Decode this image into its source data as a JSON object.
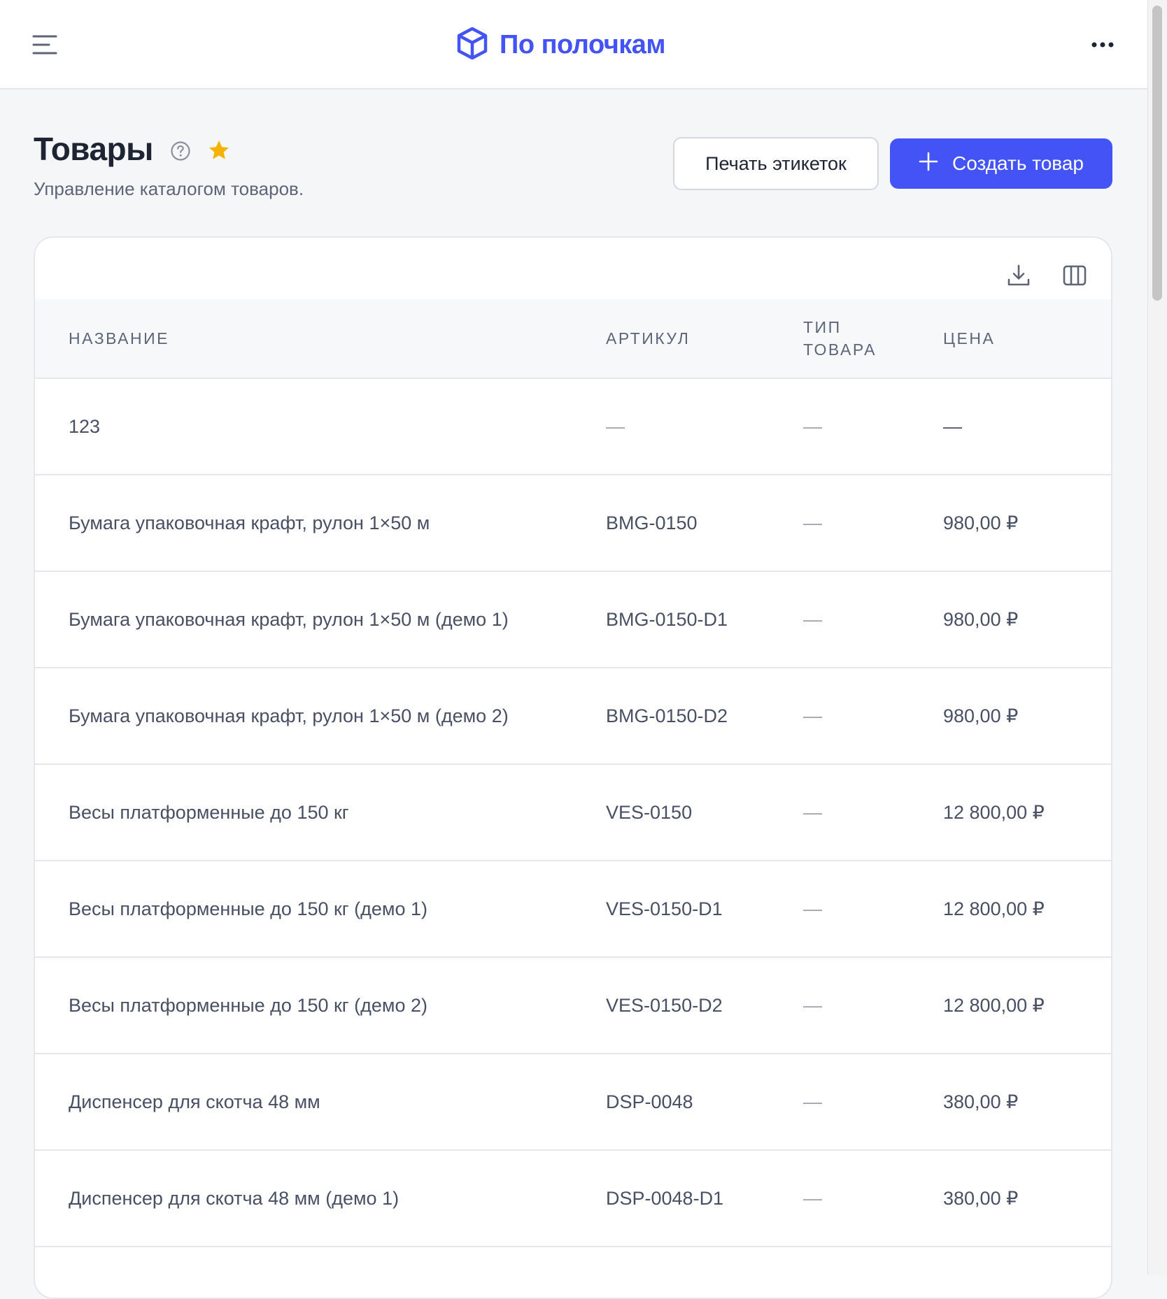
{
  "brand": {
    "name": "По полочкам"
  },
  "page": {
    "title": "Товары",
    "subtitle": "Управление каталогом товаров."
  },
  "actions": {
    "print_labels": "Печать этикеток",
    "create_product": "Создать товар"
  },
  "table": {
    "columns": {
      "name": "НАЗВАНИЕ",
      "sku": "АРТИКУЛ",
      "type_line1": "ТИП",
      "type_line2": "ТОВАРА",
      "price": "ЦЕНА"
    },
    "rows": [
      {
        "name": "123",
        "sku": "—",
        "type": "—",
        "price": "—"
      },
      {
        "name": "Бумага упаковочная крафт, рулон 1×50 м",
        "sku": "BMG-0150",
        "type": "—",
        "price": "980,00 ₽"
      },
      {
        "name": "Бумага упаковочная крафт, рулон 1×50 м (демо 1)",
        "sku": "BMG-0150-D1",
        "type": "—",
        "price": "980,00 ₽"
      },
      {
        "name": "Бумага упаковочная крафт, рулон 1×50 м (демо 2)",
        "sku": "BMG-0150-D2",
        "type": "—",
        "price": "980,00 ₽"
      },
      {
        "name": "Весы платформенные до 150 кг",
        "sku": "VES-0150",
        "type": "—",
        "price": "12 800,00 ₽"
      },
      {
        "name": "Весы платформенные до 150 кг (демо 1)",
        "sku": "VES-0150-D1",
        "type": "—",
        "price": "12 800,00 ₽"
      },
      {
        "name": "Весы платформенные до 150 кг (демо 2)",
        "sku": "VES-0150-D2",
        "type": "—",
        "price": "12 800,00 ₽"
      },
      {
        "name": "Диспенсер для скотча 48 мм",
        "sku": "DSP-0048",
        "type": "—",
        "price": "380,00 ₽"
      },
      {
        "name": "Диспенсер для скотча 48 мм (демо 1)",
        "sku": "DSP-0048-D1",
        "type": "—",
        "price": "380,00 ₽"
      }
    ]
  },
  "colors": {
    "accent": "#4353f5",
    "star": "#f5b301",
    "background": "#f5f6f8"
  },
  "icons": {
    "menu": "menu-icon",
    "logo": "cube-icon",
    "more": "more-horizontal-icon",
    "help": "help-circle-icon",
    "favorite": "star-icon",
    "plus": "plus-icon",
    "download": "download-icon",
    "columns": "columns-icon"
  }
}
